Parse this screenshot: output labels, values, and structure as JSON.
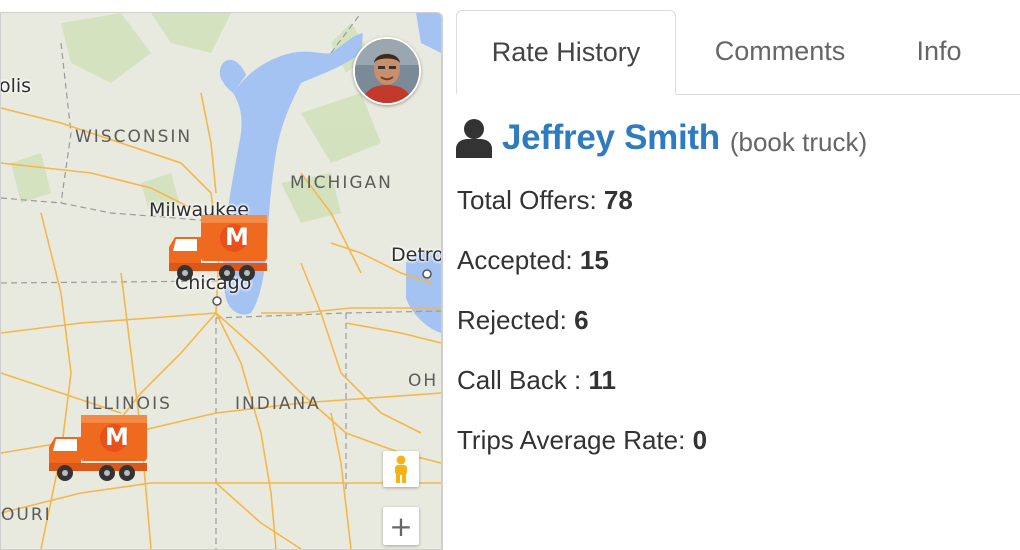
{
  "map": {
    "state_labels": {
      "wisconsin": "WISCONSIN",
      "michigan": "MICHIGAN",
      "illinois": "ILLINOIS",
      "indiana": "INDIANA",
      "ohio": "OH",
      "missouri": "OURI"
    },
    "city_labels": {
      "minneapolis": "olis",
      "milwaukee": "Milwaukee",
      "chicago": "Chicago",
      "detroit": "Detro"
    },
    "truck_badge_letter": "M",
    "zoom_in_label": "+",
    "colors": {
      "land": "#e9eadf",
      "water": "#a4c3f2",
      "highway": "#f5b64a",
      "truck": "#ef6a1f"
    }
  },
  "tabs": [
    {
      "label": "Rate History",
      "active": true
    },
    {
      "label": "Comments",
      "active": false
    },
    {
      "label": "Info",
      "active": false
    }
  ],
  "driver": {
    "name": "Jeffrey Smith",
    "note": "(book truck)"
  },
  "stats": {
    "total_offers_label": "Total Offers:",
    "total_offers_value": "78",
    "accepted_label": "Accepted:",
    "accepted_value": "15",
    "rejected_label": "Rejected:",
    "rejected_value": "6",
    "call_back_label": "Call Back :",
    "call_back_value": "11",
    "avg_rate_label": "Trips Average Rate:",
    "avg_rate_value": "0"
  },
  "accent_color": "#2e7bc0"
}
